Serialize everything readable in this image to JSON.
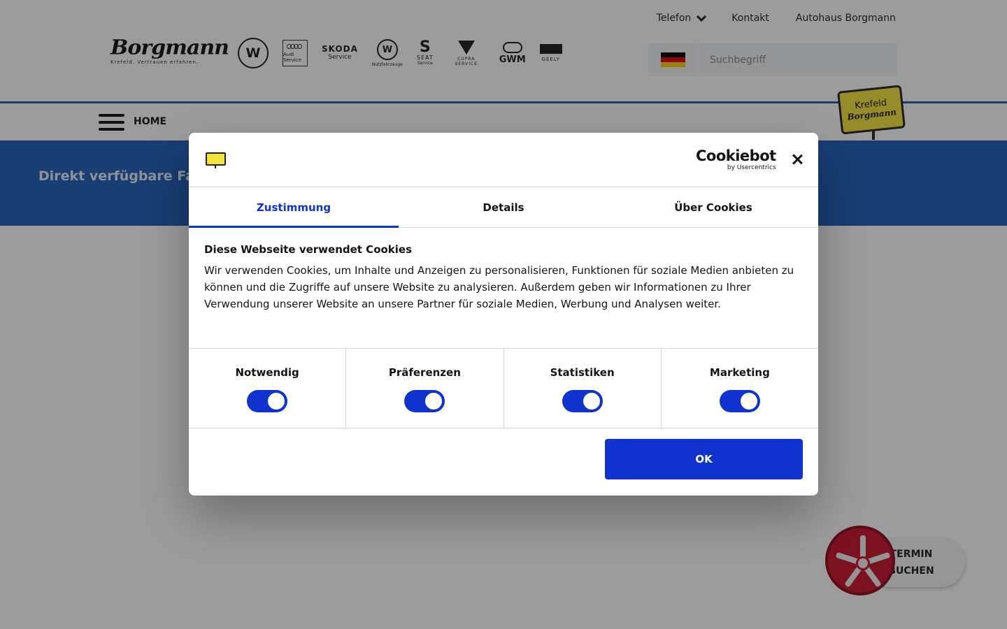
{
  "topnav": {
    "telefon": "Telefon",
    "kontakt": "Kontakt",
    "autohaus": "Autohaus Borgmann"
  },
  "logo": {
    "name": "Borgmann",
    "tagline": "Krefeld. Vertrauen erfahren."
  },
  "brands": {
    "audi": "Audi Service",
    "skoda": "SKODA",
    "skoda_sub": "Service",
    "vw_nutz": "Nutzfahrzeuge",
    "seat": "SEAT",
    "seat_sub": "Service",
    "cupra": "CUPRA SERVICE",
    "gwm": "GWM",
    "geely": "GEELY"
  },
  "search": {
    "placeholder": "Suchbegriff"
  },
  "menu": {
    "home": "HOME"
  },
  "sign": {
    "line1": "Krefeld",
    "line2": "Borgmann"
  },
  "hero": {
    "text": "Direkt verfügbare Fahr"
  },
  "termin": {
    "label": "TERMIN BUCHEN"
  },
  "dialog": {
    "cookiebot": "Cookiebot",
    "cookiebot_sub": "by Usercentrics",
    "tabs": [
      "Zustimmung",
      "Details",
      "Über Cookies"
    ],
    "title": "Diese Webseite verwendet Cookies",
    "text": "Wir verwenden Cookies, um Inhalte und Anzeigen zu personalisieren, Funktionen für soziale Medien anbieten zu können und die Zugriffe auf unsere Website zu analysieren. Außerdem geben wir Informationen zu Ihrer Verwendung unserer Website an unsere Partner für soziale Medien, Werbung und Analysen weiter.",
    "toggles": [
      "Notwendig",
      "Präferenzen",
      "Statistiken",
      "Marketing"
    ],
    "ok": "OK"
  },
  "colors": {
    "accent": "#1032cf",
    "hero": "#1c5db8",
    "sign": "#f5e33c",
    "wheel": "#c8112a"
  }
}
